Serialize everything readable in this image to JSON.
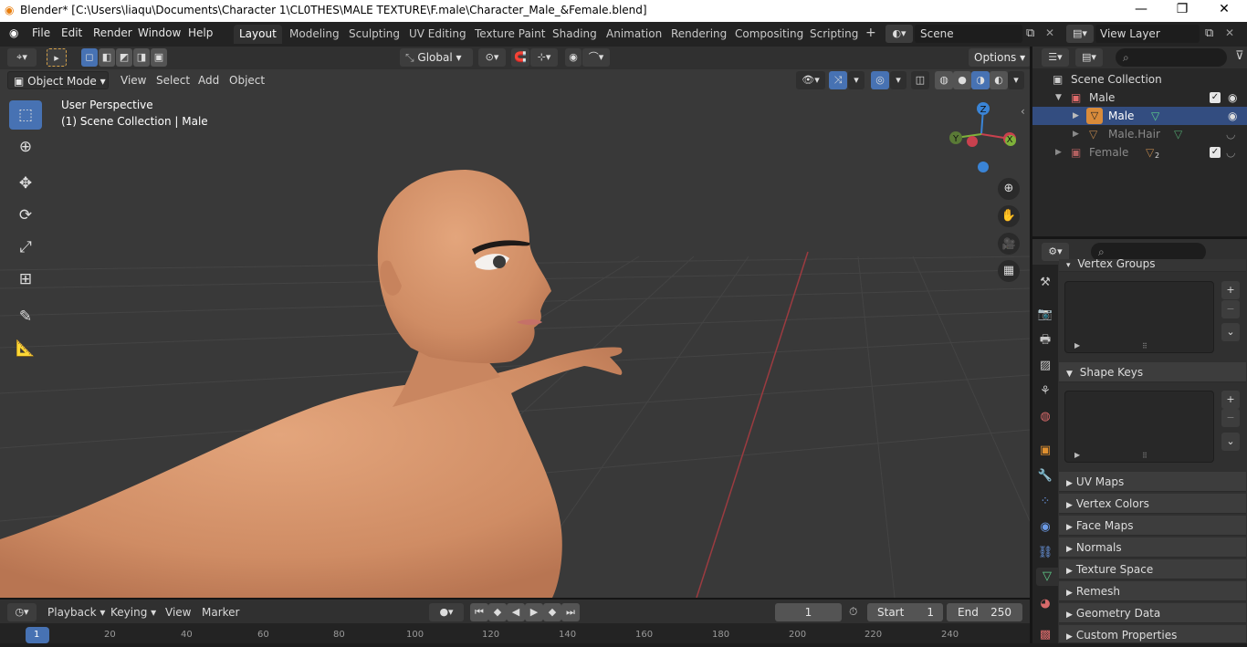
{
  "window": {
    "title": "Blender* [C:\\Users\\liaqu\\Documents\\Character 1\\CL0THES\\MALE TEXTURE\\F.male\\Character_Male_&Female.blend]",
    "minimize": "—",
    "maximize": "❐",
    "close": "✕"
  },
  "menu": [
    "File",
    "Edit",
    "Render",
    "Window",
    "Help"
  ],
  "workspaces": [
    "Layout",
    "Modeling",
    "Sculpting",
    "UV Editing",
    "Texture Paint",
    "Shading",
    "Animation",
    "Rendering",
    "Compositing",
    "Scripting"
  ],
  "workspace_add": "+",
  "scene": {
    "label": "Scene"
  },
  "view_layer": {
    "label": "View Layer"
  },
  "viewport_header": {
    "transform_orientation": "Global",
    "options": "Options",
    "mode": "Object Mode",
    "menus": [
      "View",
      "Select",
      "Add",
      "Object"
    ]
  },
  "overlay": {
    "line1": "User Perspective",
    "line2": "(1) Scene Collection | Male"
  },
  "gizmo": {
    "z": "Z",
    "y": "Y",
    "x": "X"
  },
  "outliner": {
    "root": "Scene Collection",
    "rows": [
      {
        "label": "Male",
        "type": "collection"
      },
      {
        "label": "Male",
        "type": "object"
      },
      {
        "label": "Male.Hair",
        "type": "object"
      },
      {
        "label": "Female",
        "type": "collection"
      }
    ],
    "female_badge": "2"
  },
  "properties": {
    "sections_top": "Vertex Groups",
    "shape_keys": "Shape Keys",
    "collapsed": [
      "UV Maps",
      "Vertex Colors",
      "Face Maps",
      "Normals",
      "Texture Space",
      "Remesh",
      "Geometry Data",
      "Custom Properties"
    ]
  },
  "timeline": {
    "playback": "Playback",
    "keying": "Keying",
    "view": "View",
    "marker": "Marker",
    "current_frame": "1",
    "start_label": "Start",
    "start": "1",
    "end_label": "End",
    "end": "250",
    "ruler": [
      "1",
      "20",
      "40",
      "60",
      "80",
      "100",
      "120",
      "140",
      "160",
      "180",
      "200",
      "220",
      "240"
    ]
  },
  "colors": {
    "accent": "#4772b3",
    "x_axis": "#c9414e",
    "y_axis": "#7fb23a",
    "z_axis": "#3a84d6",
    "skin": "#d7966d"
  }
}
